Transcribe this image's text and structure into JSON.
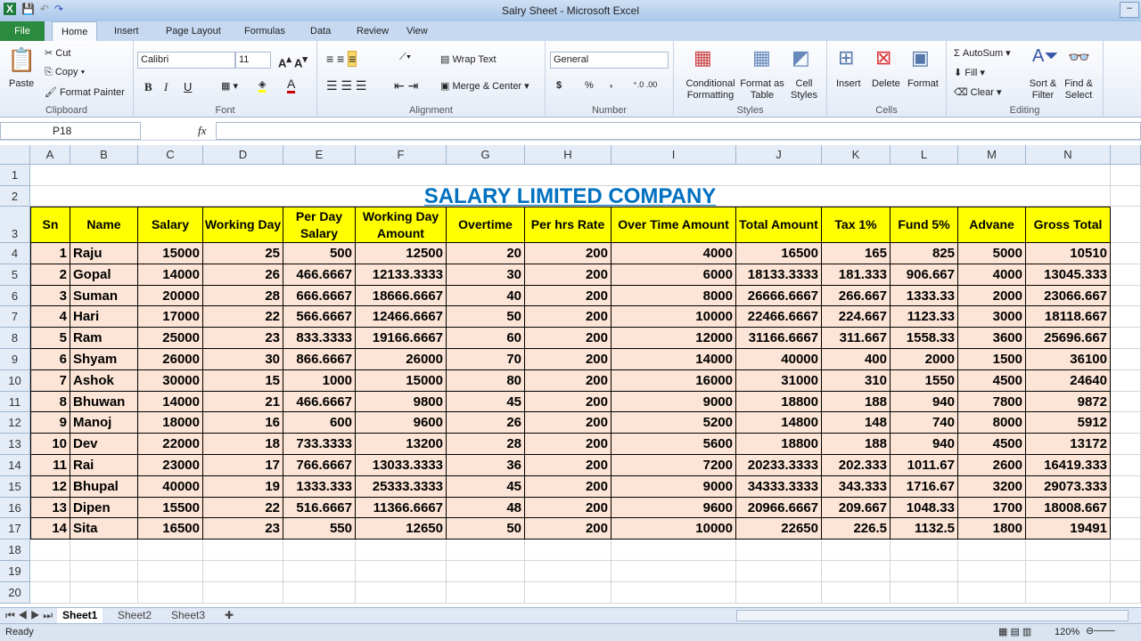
{
  "window": {
    "title": "Salry Sheet  -  Microsoft Excel",
    "app_icon": "X"
  },
  "tabs": [
    "File",
    "Home",
    "Insert",
    "Page Layout",
    "Formulas",
    "Data",
    "Review",
    "View"
  ],
  "ribbon": {
    "clipboard": {
      "label": "Clipboard",
      "paste": "Paste",
      "cut": "Cut",
      "copy": "Copy",
      "format_painter": "Format Painter"
    },
    "font": {
      "label": "Font",
      "font_name": "Calibri",
      "font_size": "11",
      "bold": "B",
      "italic": "I",
      "underline": "U"
    },
    "alignment": {
      "label": "Alignment",
      "wrap_text": "Wrap Text",
      "merge_center": "Merge & Center"
    },
    "number": {
      "label": "Number",
      "format": "General",
      "currency": "$",
      "percent": "%",
      "comma": ","
    },
    "styles": {
      "label": "Styles",
      "conditional": "Conditional Formatting",
      "format_table": "Format as Table",
      "cell_styles": "Cell Styles"
    },
    "cells": {
      "label": "Cells",
      "insert": "Insert",
      "delete": "Delete",
      "format": "Format"
    },
    "editing": {
      "label": "Editing",
      "autosum": "AutoSum",
      "fill": "Fill",
      "clear": "Clear",
      "sort_filter": "Sort & Filter",
      "find_select": "Find & Select"
    }
  },
  "formula_bar": {
    "name_box": "P18",
    "fx": "fx",
    "value": ""
  },
  "columns": [
    "A",
    "B",
    "C",
    "D",
    "E",
    "F",
    "G",
    "H",
    "I",
    "J",
    "K",
    "L",
    "M",
    "N"
  ],
  "rows": [
    "1",
    "2",
    "3",
    "4",
    "5",
    "6",
    "7",
    "8",
    "9",
    "10",
    "11",
    "12",
    "13",
    "14",
    "15",
    "16",
    "17",
    "18",
    "19",
    "20"
  ],
  "sheet": {
    "title": "SALARY LIMITED COMPANY",
    "headers": [
      "Sn",
      "Name",
      "Salary",
      "Working Day",
      "Per Day Salary",
      "Working Day Amount",
      "Overtime",
      "Per hrs Rate",
      "Over Time Amount",
      "Total Amount",
      "Tax 1%",
      "Fund 5%",
      "Advane",
      "Gross Total"
    ],
    "data": [
      [
        "1",
        "Raju",
        "15000",
        "25",
        "500",
        "12500",
        "20",
        "200",
        "4000",
        "16500",
        "165",
        "825",
        "5000",
        "10510"
      ],
      [
        "2",
        "Gopal",
        "14000",
        "26",
        "466.6667",
        "12133.3333",
        "30",
        "200",
        "6000",
        "18133.3333",
        "181.333",
        "906.667",
        "4000",
        "13045.333"
      ],
      [
        "3",
        "Suman",
        "20000",
        "28",
        "666.6667",
        "18666.6667",
        "40",
        "200",
        "8000",
        "26666.6667",
        "266.667",
        "1333.33",
        "2000",
        "23066.667"
      ],
      [
        "4",
        "Hari",
        "17000",
        "22",
        "566.6667",
        "12466.6667",
        "50",
        "200",
        "10000",
        "22466.6667",
        "224.667",
        "1123.33",
        "3000",
        "18118.667"
      ],
      [
        "5",
        "Ram",
        "25000",
        "23",
        "833.3333",
        "19166.6667",
        "60",
        "200",
        "12000",
        "31166.6667",
        "311.667",
        "1558.33",
        "3600",
        "25696.667"
      ],
      [
        "6",
        "Shyam",
        "26000",
        "30",
        "866.6667",
        "26000",
        "70",
        "200",
        "14000",
        "40000",
        "400",
        "2000",
        "1500",
        "36100"
      ],
      [
        "7",
        "Ashok",
        "30000",
        "15",
        "1000",
        "15000",
        "80",
        "200",
        "16000",
        "31000",
        "310",
        "1550",
        "4500",
        "24640"
      ],
      [
        "8",
        "Bhuwan",
        "14000",
        "21",
        "466.6667",
        "9800",
        "45",
        "200",
        "9000",
        "18800",
        "188",
        "940",
        "7800",
        "9872"
      ],
      [
        "9",
        "Manoj",
        "18000",
        "16",
        "600",
        "9600",
        "26",
        "200",
        "5200",
        "14800",
        "148",
        "740",
        "8000",
        "5912"
      ],
      [
        "10",
        "Dev",
        "22000",
        "18",
        "733.3333",
        "13200",
        "28",
        "200",
        "5600",
        "18800",
        "188",
        "940",
        "4500",
        "13172"
      ],
      [
        "11",
        "Rai",
        "23000",
        "17",
        "766.6667",
        "13033.3333",
        "36",
        "200",
        "7200",
        "20233.3333",
        "202.333",
        "1011.67",
        "2600",
        "16419.333"
      ],
      [
        "12",
        "Bhupal",
        "40000",
        "19",
        "1333.333",
        "25333.3333",
        "45",
        "200",
        "9000",
        "34333.3333",
        "343.333",
        "1716.67",
        "3200",
        "29073.333"
      ],
      [
        "13",
        "Dipen",
        "15500",
        "22",
        "516.6667",
        "11366.6667",
        "48",
        "200",
        "9600",
        "20966.6667",
        "209.667",
        "1048.33",
        "1700",
        "18008.667"
      ],
      [
        "14",
        "Sita",
        "16500",
        "23",
        "550",
        "12650",
        "50",
        "200",
        "10000",
        "22650",
        "226.5",
        "1132.5",
        "1800",
        "19491"
      ]
    ]
  },
  "sheet_tabs": [
    "Sheet1",
    "Sheet2",
    "Sheet3"
  ],
  "status": {
    "ready": "Ready",
    "zoom": "120%"
  },
  "colors": {
    "header_fill": "#ffff00",
    "data_fill": "#fce4d6",
    "title": "#0070c0"
  }
}
